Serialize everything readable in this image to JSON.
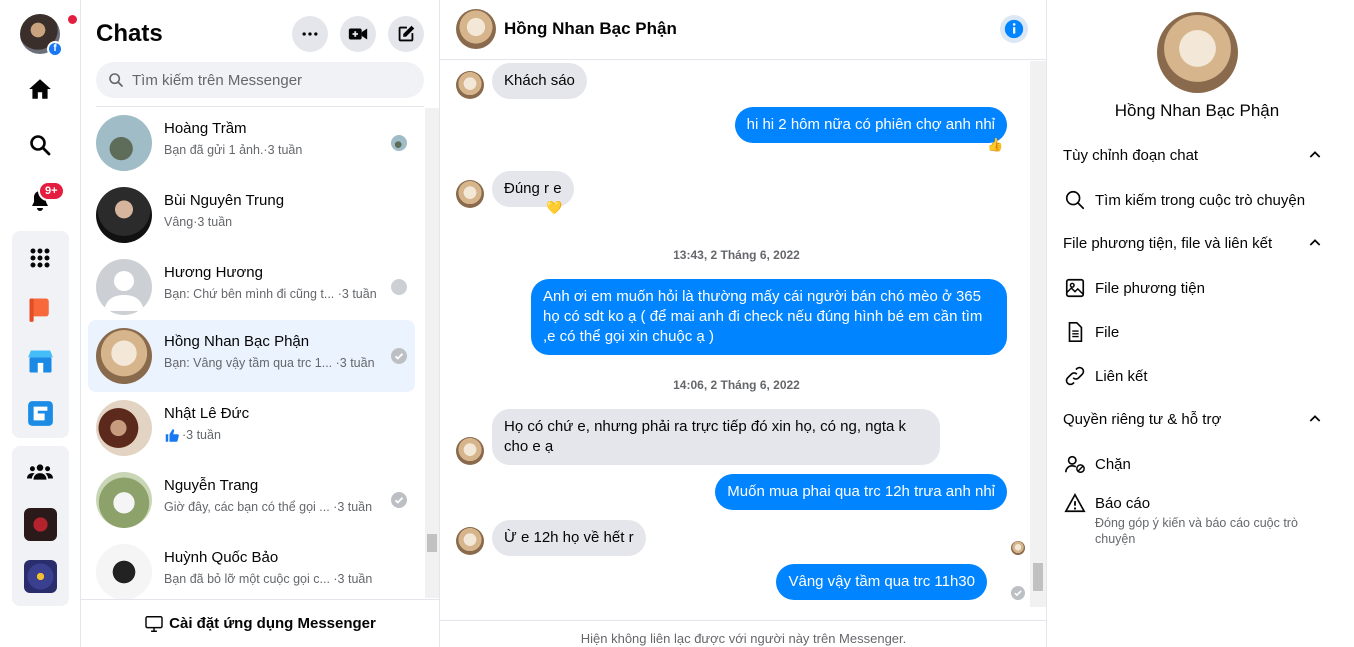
{
  "rail": {
    "notification_badge": "9+",
    "profile_badge": "f"
  },
  "list": {
    "title": "Chats",
    "search_placeholder": "Tìm kiếm trên Messenger",
    "conversations": [
      {
        "name": "Hoàng Trầm",
        "preview": "Bạn đã gửi 1 ảnh.·3 tuần"
      },
      {
        "name": "Bùi Nguyên Trung",
        "preview": "Vâng·3 tuần"
      },
      {
        "name": "Hương Hương",
        "preview": "Bạn: Chứ bên mình đi cũng t... ·3 tuần"
      },
      {
        "name": "Hồng Nhan Bạc Phận",
        "preview": "Bạn: Vâng vậy tầm qua trc 1... ·3 tuần"
      },
      {
        "name": "Nhật Lê Đức",
        "preview": "·3 tuần"
      },
      {
        "name": "Nguyễn Trang",
        "preview": "Giờ đây, các bạn có thể gọi ... ·3 tuần"
      },
      {
        "name": "Huỳnh Quốc Bảo",
        "preview": "Bạn đã bỏ lỡ một cuộc gọi c... ·3 tuần"
      }
    ],
    "footer": "Cài đặt ứng dụng Messenger"
  },
  "thread": {
    "title": "Hồng Nhan Bạc Phận",
    "messages": [
      "Khách sáo",
      "hi hi 2 hôm nữa có phiên chợ anh nhỉ",
      "Đúng r e",
      "Anh ơi em muốn hỏi là thường mấy cái người bán chó mèo ở 365 họ có sdt ko ạ ( để mai anh đi check nếu đúng hình bé em cần tìm ,e có thể gọi xin chuộc ạ )",
      "Họ có chứ e, nhưng phải ra trực tiếp đó xin họ, có ng, ngta k cho e ạ",
      "Muốn mua phai qua trc 12h trưa anh nhỉ",
      "Ừ e 12h họ về hết r",
      "Vâng vậy tầm qua trc 11h30"
    ],
    "timestamps": [
      "13:43, 2 Tháng 6, 2022",
      "14:06, 2 Tháng 6, 2022"
    ],
    "reactions": [
      "👍",
      "💛"
    ],
    "footer_notice": "Hiện không liên lạc được với người này trên Messenger."
  },
  "details": {
    "name": "Hồng Nhan Bạc Phận",
    "sections": {
      "customize": "Tùy chỉnh đoạn chat",
      "media": "File phương tiện, file và liên kết",
      "privacy": "Quyền riêng tư & hỗ trợ"
    },
    "items": {
      "search": "Tìm kiếm trong cuộc trò chuyện",
      "media_files": "File phương tiện",
      "files": "File",
      "links": "Liên kết",
      "block": "Chặn",
      "report": "Báo cáo",
      "report_desc": "Đóng góp ý kiến và báo cáo cuộc trò chuyện"
    }
  },
  "colors": {
    "accent": "#0084ff",
    "incoming_bubble": "#e4e6eb",
    "active_row": "#ebf3ff",
    "badge": "#e41e3f"
  }
}
